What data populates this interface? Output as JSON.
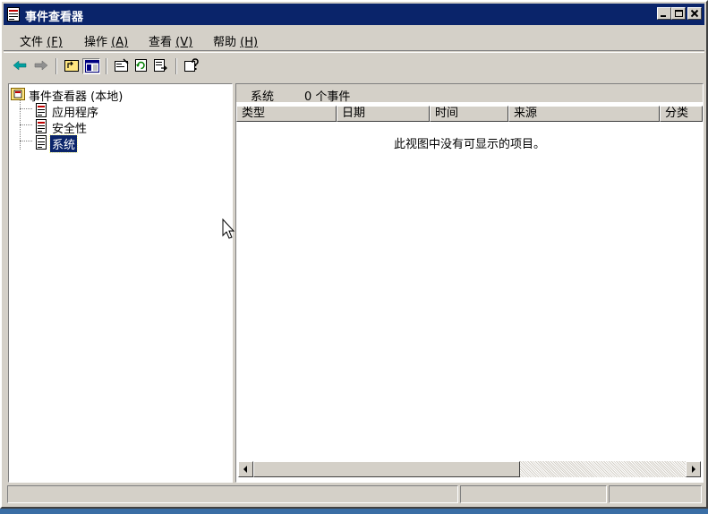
{
  "window": {
    "title": "事件查看器",
    "title_icon": "event-viewer-icon"
  },
  "menubar": {
    "items": [
      {
        "label": "文件",
        "mnemonic": "(F)"
      },
      {
        "label": "操作",
        "mnemonic": "(A)"
      },
      {
        "label": "查看",
        "mnemonic": "(V)"
      },
      {
        "label": "帮助",
        "mnemonic": "(H)"
      }
    ]
  },
  "toolbar": {
    "buttons": [
      "back-arrow-icon",
      "forward-arrow-icon",
      "up-one-level-icon",
      "show-hide-tree-icon",
      "properties-icon",
      "refresh-icon",
      "export-list-icon",
      "help-icon"
    ]
  },
  "tree": {
    "root": {
      "label": "事件查看器 (本地)",
      "icon": "event-viewer-icon"
    },
    "children": [
      {
        "label": "应用程序",
        "icon": "log-icon",
        "selected": false
      },
      {
        "label": "安全性",
        "icon": "log-icon",
        "selected": false
      },
      {
        "label": "系统",
        "icon": "log-icon",
        "selected": true
      }
    ]
  },
  "pane": {
    "name": "系统",
    "count": "0 个事件",
    "columns": [
      "类型",
      "日期",
      "时间",
      "来源",
      "分类"
    ],
    "empty_message": "此视图中没有可显示的项目。"
  },
  "colors": {
    "titlebar": "#0a246a",
    "face": "#d4d0c8",
    "selection": "#0a246a"
  }
}
